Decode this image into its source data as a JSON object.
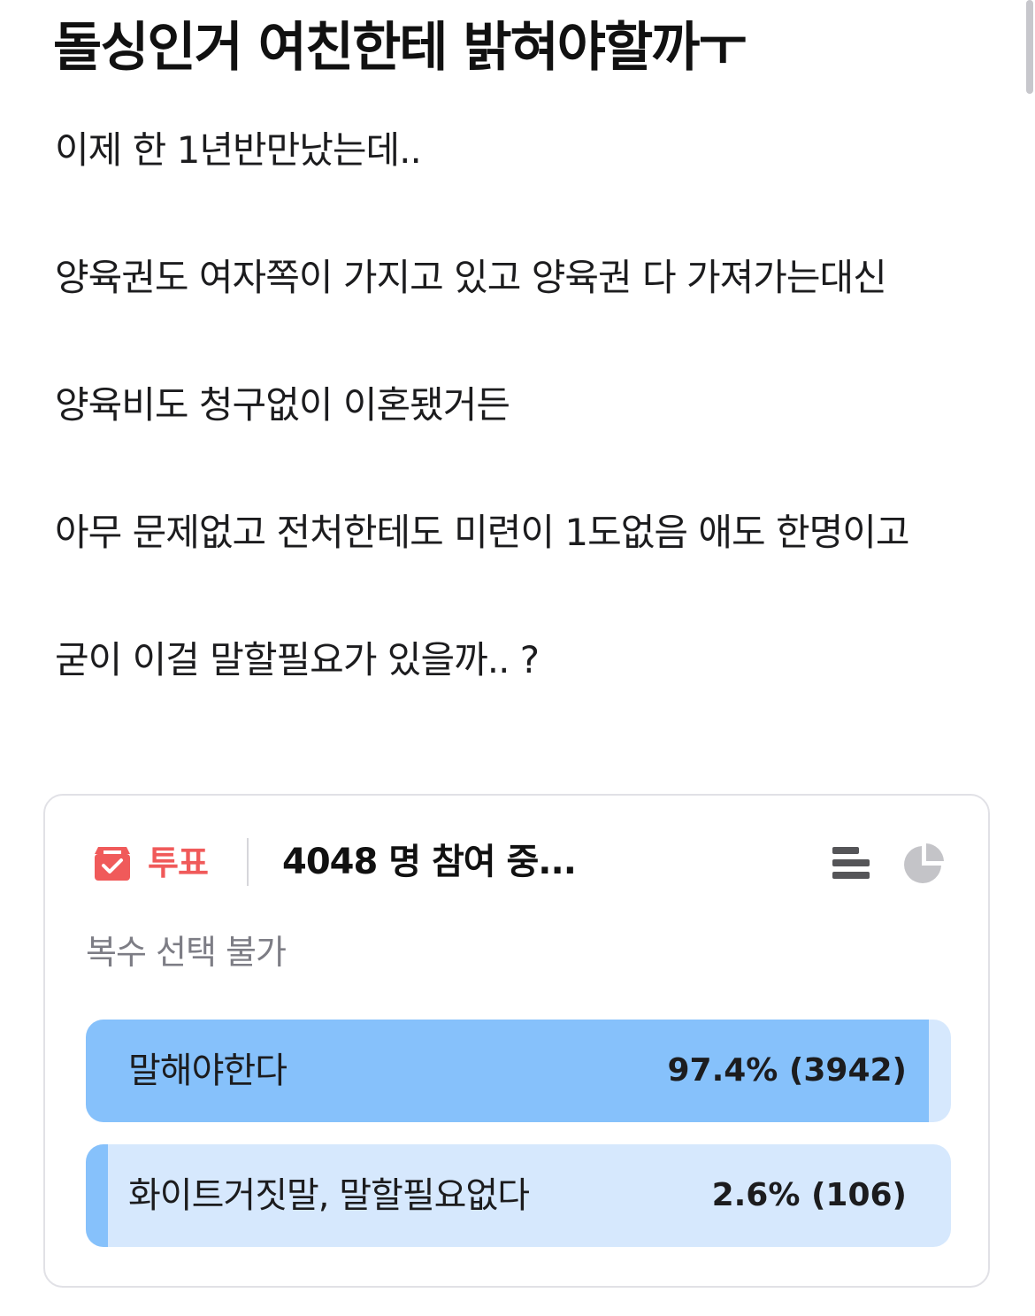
{
  "post": {
    "title": "돌싱인거 여친한테 밝혀야할까ㅜ",
    "paragraphs": [
      "이제 한 1년반만났는데..",
      "양육권도 여자쪽이 가지고 있고 양육권 다 가져가는대신",
      "양육비도 청구없이 이혼됐거든",
      "아무 문제없고 전처한테도 미련이 1도없음 애도 한명이고",
      "굳이 이걸 말할필요가 있을까.. ?"
    ]
  },
  "poll": {
    "label": "투표",
    "participants": "4048 명 참여 중...",
    "mode": "복수 선택 불가",
    "icons": {
      "poll": "ballot-box-icon",
      "bar_view": "bar-chart-view-icon",
      "pie_view": "pie-chart-view-icon"
    },
    "colors": {
      "accent": "#f05a5a",
      "bar_fill": "#86c1fb",
      "bar_track": "#d6e8fd"
    },
    "options": [
      {
        "label": "말해야한다",
        "percent": 97.4,
        "result": "97.4% (3942)"
      },
      {
        "label": "화이트거짓말, 말할필요없다",
        "percent": 2.6,
        "result": "2.6% (106)"
      }
    ]
  }
}
